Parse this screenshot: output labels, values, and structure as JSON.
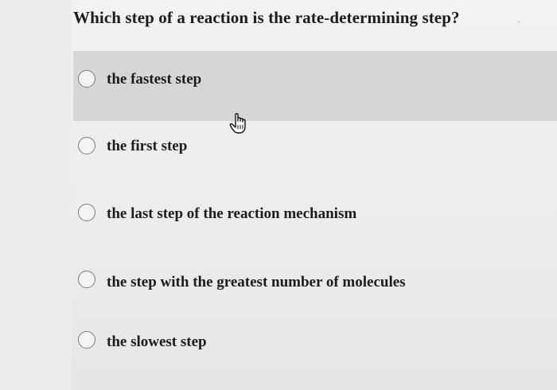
{
  "question": {
    "text": "Which step of a reaction is the rate-determining step?"
  },
  "corner_mark": "ˏ",
  "options": [
    {
      "label": "the fastest step",
      "selected": false,
      "hovered": true
    },
    {
      "label": "the first step",
      "selected": false,
      "hovered": false
    },
    {
      "label": "the last step of the reaction mechanism",
      "selected": false,
      "hovered": false
    },
    {
      "label": "the step with the greatest number of molecules",
      "selected": false,
      "hovered": false
    },
    {
      "label": "the slowest step",
      "selected": false,
      "hovered": false
    }
  ],
  "cursor": {
    "icon": "hand-pointer-icon"
  }
}
